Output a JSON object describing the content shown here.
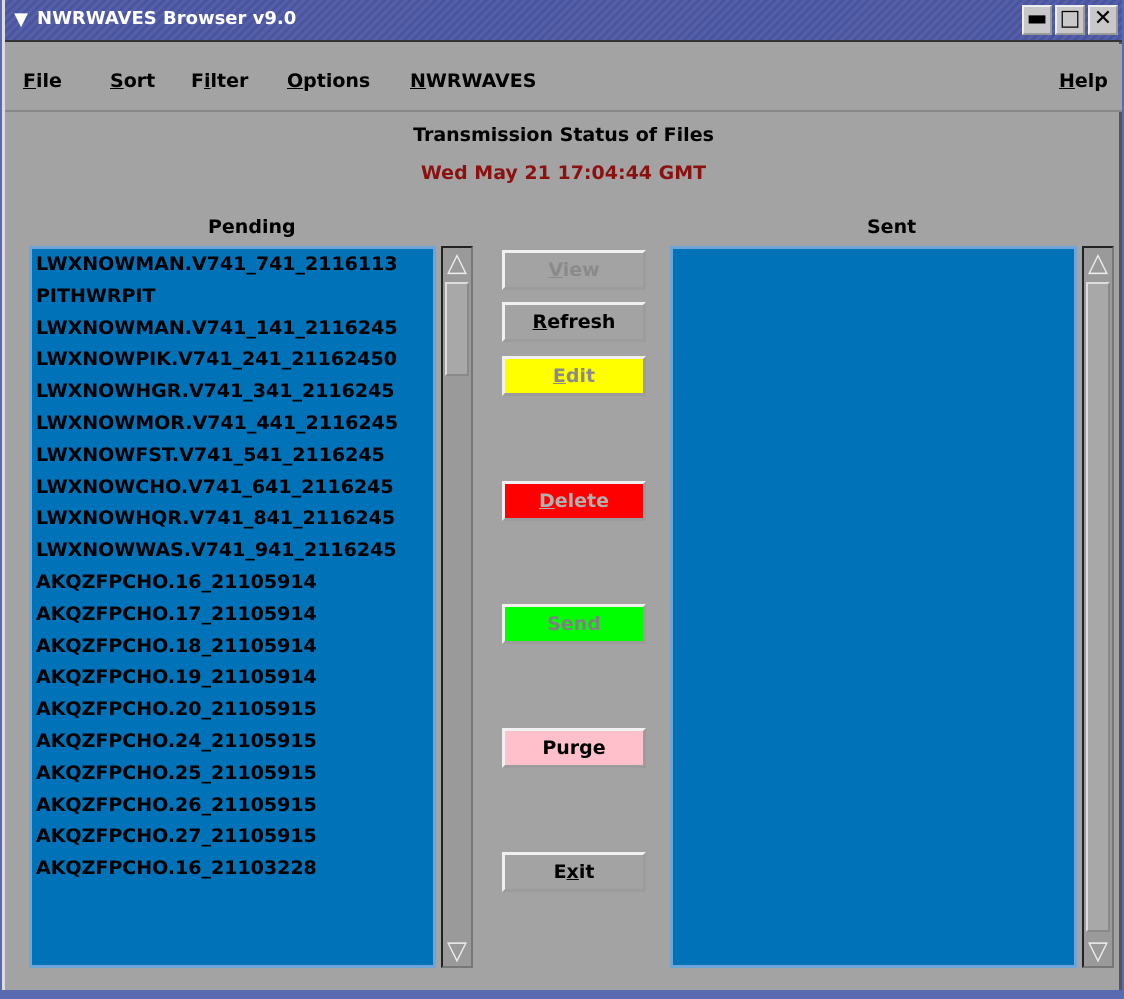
{
  "window": {
    "title": "NWRWAVES Browser v9.0",
    "menu_glyph": "▼",
    "min": "▬",
    "max": "□",
    "close": "✕"
  },
  "menu": {
    "file": {
      "u": "F",
      "rest": "ile"
    },
    "sort": {
      "u": "S",
      "rest": "ort"
    },
    "filter": {
      "pre": "F",
      "u": "i",
      "rest": "lter"
    },
    "options": {
      "u": "O",
      "rest": "ptions"
    },
    "nwrwaves": {
      "u": "N",
      "rest": "WRWAVES"
    },
    "help": {
      "u": "H",
      "rest": "elp"
    }
  },
  "status": {
    "title": "Transmission Status of Files",
    "time": "Wed May 21  17:04:44 GMT"
  },
  "pending": {
    "label": "Pending",
    "items": [
      "LWXNOWMAN.V741_741_2116113",
      "PITHWRPIT",
      "LWXNOWMAN.V741_141_2116245",
      "LWXNOWPIK.V741_241_21162450",
      "LWXNOWHGR.V741_341_2116245",
      "LWXNOWMOR.V741_441_2116245",
      "LWXNOWFST.V741_541_2116245",
      "LWXNOWCHO.V741_641_2116245",
      "LWXNOWHQR.V741_841_2116245",
      "LWXNOWWAS.V741_941_2116245",
      "AKQZFPCHO.16_21105914",
      "AKQZFPCHO.17_21105914",
      "AKQZFPCHO.18_21105914",
      "AKQZFPCHO.19_21105914",
      "AKQZFPCHO.20_21105915",
      "AKQZFPCHO.24_21105915",
      "AKQZFPCHO.25_21105915",
      "AKQZFPCHO.26_21105915",
      "AKQZFPCHO.27_21105915",
      "AKQZFPCHO.16_21103228"
    ]
  },
  "sent": {
    "label": "Sent",
    "items": []
  },
  "scroll": {
    "up": "△",
    "down": "▽"
  },
  "buttons": {
    "view": {
      "u": "V",
      "rest": "iew"
    },
    "refresh": {
      "u": "R",
      "rest": "efresh"
    },
    "edit": {
      "u": "E",
      "rest": "dit"
    },
    "delete": {
      "u": "D",
      "rest": "elete"
    },
    "send": {
      "label": "Send"
    },
    "purge": {
      "label": "Purge"
    },
    "exit": {
      "pre": "E",
      "u": "x",
      "rest": "it"
    }
  },
  "colors": {
    "list_bg": "#0072b8",
    "edit_btn": "#ffff00",
    "delete_btn": "#ff0000",
    "send_btn": "#00ff00",
    "purge_btn": "#ffc0cb",
    "time_text": "#8b1010"
  }
}
